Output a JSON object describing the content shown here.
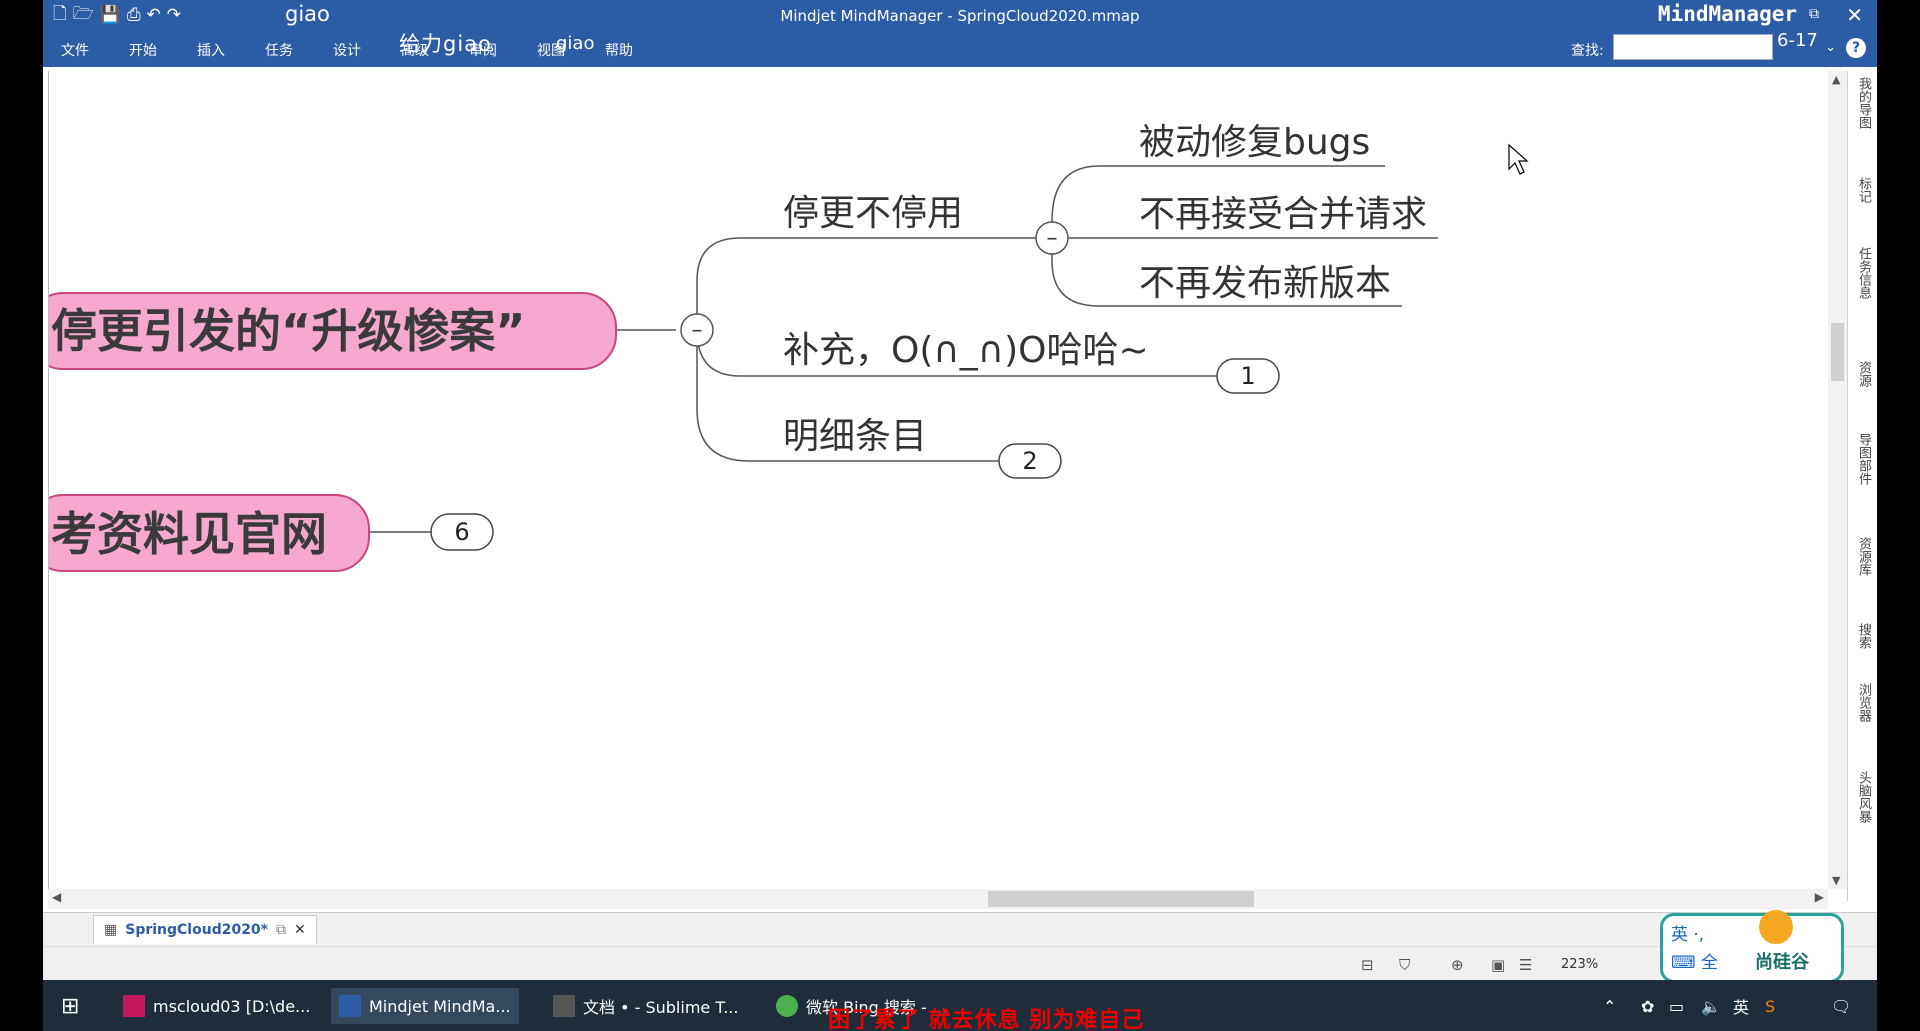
{
  "window": {
    "title": "Mindjet MindManager - SpringCloud2020.mmap",
    "brand": "MindManager",
    "restore_icon": "⧉",
    "close_icon": "✕"
  },
  "qat": {
    "giao": "giao"
  },
  "menu": [
    "文件",
    "开始",
    "插入",
    "任务",
    "设计",
    "高级",
    "审阅",
    "视图",
    "帮助"
  ],
  "overlays": {
    "big": "给力giao",
    "small": "giao"
  },
  "find": {
    "label": "查找:",
    "value": "",
    "counter": "6-17"
  },
  "mindmap": {
    "main1": "停更引发的“升级惨案”",
    "main2": "考资料见官网",
    "main2_badge": "6",
    "branch_a": "停更不停用",
    "sub_a1": "被动修复bugs",
    "sub_a2": "不再接受合并请求",
    "sub_a3": "不再发布新版本",
    "branch_b": "补充，O(∩_∩)O哈哈~",
    "branch_b_badge": "1",
    "branch_c": "明细条目",
    "branch_c_badge": "2",
    "collapse_symbol": "–"
  },
  "side_panel": [
    "我的导图",
    "标记",
    "任务信息",
    "资源",
    "导图部件",
    "资源库",
    "搜索",
    "浏览器",
    "头脑风暴"
  ],
  "tab": {
    "label": "SpringCloud2020*"
  },
  "status": {
    "zoom": "223%"
  },
  "logo": {
    "line1": "英 ·,",
    "line2": "⌨ 全",
    "name": "尚硅谷"
  },
  "taskbar": {
    "items": [
      "mscloud03 [D:\\de...",
      "Mindjet MindMa...",
      "文档 • - Sublime T...",
      "微软 Bing 搜索 - ..."
    ],
    "ime": "英"
  },
  "subtitle": "困了累了 就去休息 别为难自己",
  "colors": {
    "ribbon": "#2c5ca5",
    "topic": "#f7a8cf",
    "taskbar": "#1f2d3a"
  }
}
